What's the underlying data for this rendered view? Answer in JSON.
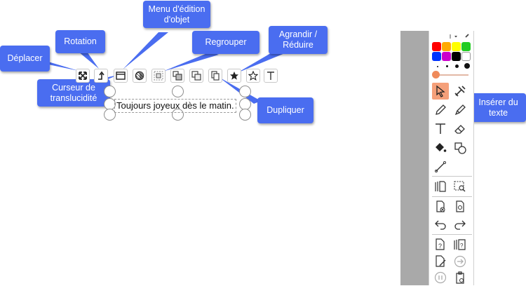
{
  "callouts": {
    "deplacer": "Déplacer",
    "rotation": "Rotation",
    "menu_edition": "Menu d'édition d'objet",
    "regrouper": "Regrouper",
    "agrandir": "Agrandir / Réduire",
    "curseur": "Curseur de translucidité",
    "dupliquer": "Dupliquer",
    "inserer": "Insérer du texte"
  },
  "canvas": {
    "text_object": "Toujours joyeux dès le matin."
  },
  "object_toolbar": {
    "icons": [
      "move-icon",
      "rotate-icon",
      "window-icon",
      "translucency-icon",
      "group-icon",
      "ungroup-icon",
      "layer-icon",
      "duplicate-icon",
      "star-filled-icon",
      "star-outline-icon",
      "text-icon"
    ]
  },
  "palette": {
    "colors": [
      "#ff0000",
      "#ffaa00",
      "#ffff00",
      "#22cc22",
      "#0033ff",
      "#cc00cc",
      "#000000",
      "#ffffff"
    ],
    "accent": "#f5a07a"
  },
  "side_tools": [
    "select-icon",
    "tools-icon",
    "pencil-icon",
    "marker-icon",
    "text-icon",
    "eraser-icon",
    "fill-bucket-icon",
    "shapes-icon",
    "line-icon",
    "pages-icon",
    "zoom-search-icon",
    "delete-page-icon",
    "reload-page-icon",
    "undo-icon",
    "redo-icon",
    "help-icon",
    "help-pages-icon",
    "edit-page-icon",
    "next-icon",
    "pause-icon",
    "clipboard-icon"
  ]
}
